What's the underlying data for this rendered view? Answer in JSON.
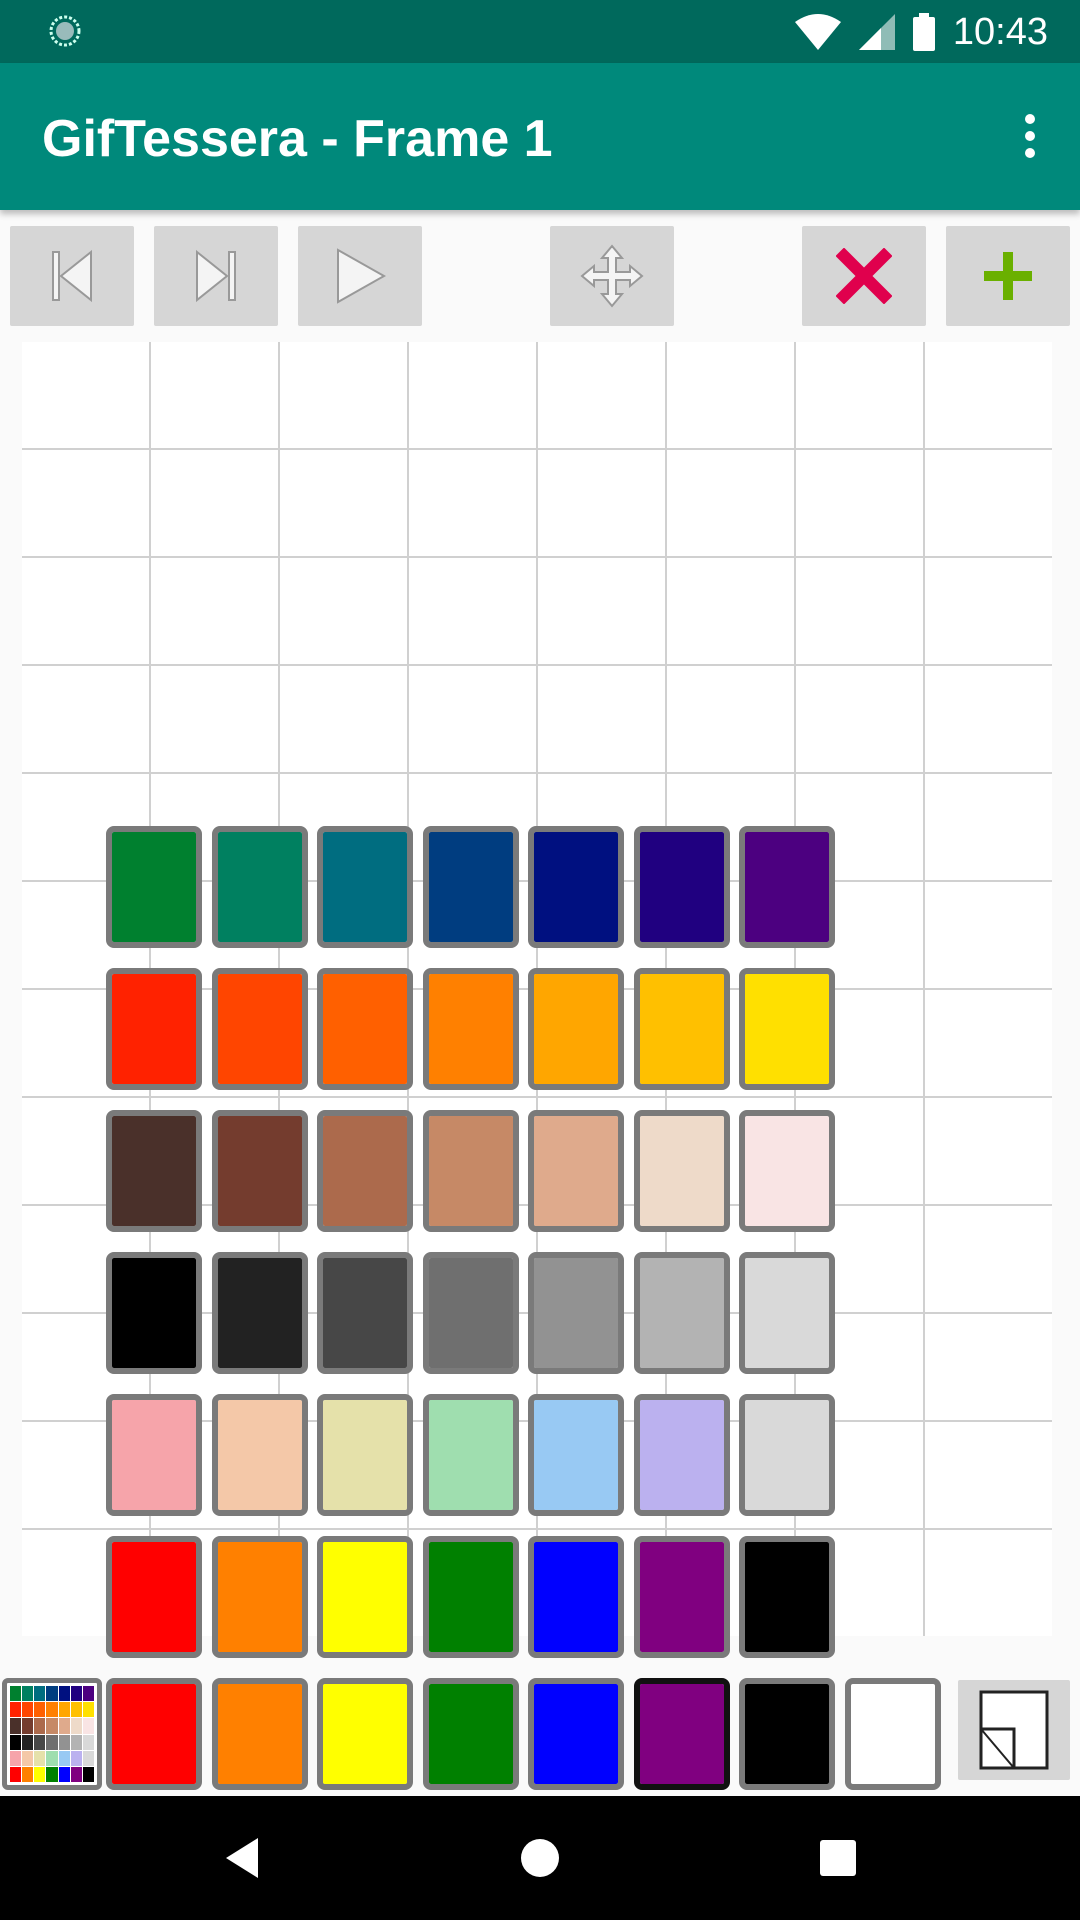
{
  "status_bar": {
    "time": "10:43"
  },
  "app_bar": {
    "title": "GifTessera - Frame 1"
  },
  "toolbar": {
    "icons": [
      "skip-previous-icon",
      "skip-next-icon",
      "play-icon",
      "move-icon",
      "delete-frame-icon",
      "add-frame-icon"
    ]
  },
  "palette": {
    "rows": [
      [
        "#00802f",
        "#008060",
        "#006d80",
        "#003d80",
        "#001080",
        "#200080",
        "#4c0080"
      ],
      [
        "#ff2200",
        "#ff4500",
        "#ff6000",
        "#ff8000",
        "#ffa600",
        "#ffc000",
        "#ffe000"
      ],
      [
        "#4a302a",
        "#743c2e",
        "#ac6a4c",
        "#c68966",
        "#dfaa8c",
        "#eedac9",
        "#f9e4e4"
      ],
      [
        "#000000",
        "#222222",
        "#474747",
        "#6f6f6f",
        "#929292",
        "#b3b3b3",
        "#d9d9d9"
      ],
      [
        "#f6a4aa",
        "#f4c8a8",
        "#e5e1aa",
        "#9fdeaf",
        "#98c9f3",
        "#bbb1ef",
        "#d9d9d9"
      ],
      [
        "#ff0000",
        "#ff8000",
        "#ffff00",
        "#008000",
        "#0000ff",
        "#800080",
        "#000000"
      ]
    ]
  },
  "color_bar": {
    "colors": [
      "#ff0000",
      "#ff8000",
      "#ffff00",
      "#008000",
      "#0000ff",
      "#800080",
      "#000000",
      "#ffffff"
    ],
    "selected_index": 5
  },
  "colors": {
    "status_bar": "#00695c",
    "app_bar": "#00897b",
    "delete": "#e0004d",
    "add": "#6ab000"
  }
}
